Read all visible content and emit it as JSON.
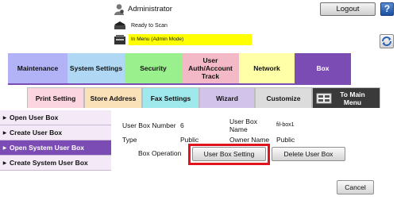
{
  "header": {
    "user_label": "Administrator",
    "logout_label": "Logout",
    "help_label": "?",
    "status_label": "Ready to Scan",
    "mode_label": "In Menu (Admin Mode)",
    "mode_color": "#ffff00"
  },
  "main_tabs": [
    {
      "label": "Maintenance",
      "color": "#b2b2f7"
    },
    {
      "label": "System Settings",
      "color": "#b0d8f5"
    },
    {
      "label": "Security",
      "color": "#9af08c"
    },
    {
      "label": "User Auth/Account Track",
      "color": "#f3b9c6"
    },
    {
      "label": "Network",
      "color": "#ffffa8"
    },
    {
      "label": "Box",
      "color": "#7b4cb3",
      "active": true
    }
  ],
  "sub_tabs": [
    {
      "label": "Print Setting",
      "color": "#fbd5df"
    },
    {
      "label": "Store Address",
      "color": "#fbe1b8"
    },
    {
      "label": "Fax Settings",
      "color": "#9fe8ec"
    },
    {
      "label": "Wizard",
      "color": "#d2c3ea"
    },
    {
      "label": "Customize",
      "color": "#dcdcdc"
    },
    {
      "label": "To Main Menu",
      "color": "#3a3a3a"
    }
  ],
  "sidebar": {
    "items": [
      {
        "label": "Open User Box",
        "active": false
      },
      {
        "label": "Create User Box",
        "active": false
      },
      {
        "label": "Open System User Box",
        "active": true
      },
      {
        "label": "Create System User Box",
        "active": false
      }
    ]
  },
  "content": {
    "box_number_label": "User Box Number",
    "box_number_value": "6",
    "box_name_label": "User Box Name",
    "box_name_value": "fil-box1",
    "type_label": "Type",
    "type_value": "Public",
    "owner_label": "Owner Name",
    "owner_value": "Public",
    "operation_label": "Box Operation",
    "setting_button": "User Box Setting",
    "delete_button": "Delete User Box",
    "cancel_button": "Cancel"
  },
  "colors": {
    "accent_purple": "#7b4cb3",
    "highlight_red": "#e0141e"
  }
}
